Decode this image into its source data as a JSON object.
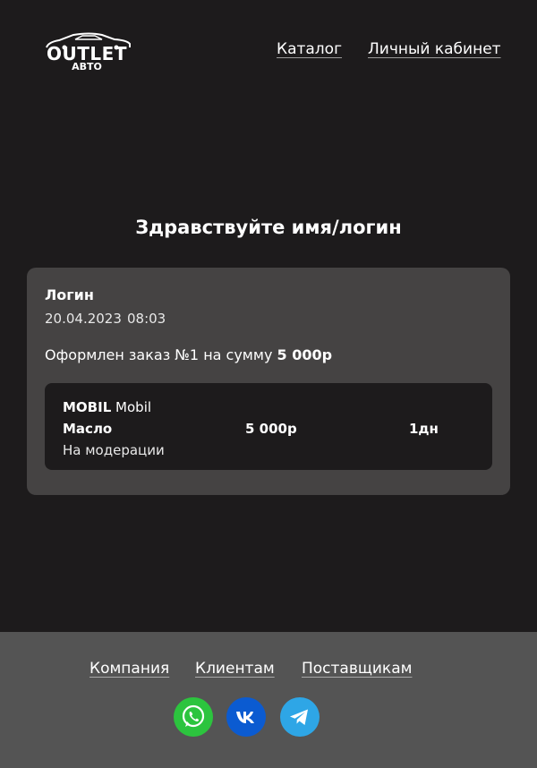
{
  "header": {
    "logo_word": "OUTLET",
    "logo_sub": "АВТО",
    "nav": {
      "catalog": "Каталог",
      "cabinet": "Личный кабинет"
    }
  },
  "main": {
    "greeting": "Здравствуйте имя/логин"
  },
  "order_card": {
    "login": "Логин",
    "date": "20.04.2023",
    "time": "08:03",
    "order_text": "Оформлен заказ №1 на сумму",
    "order_sum": "5 000р",
    "item": {
      "brand": "MOBIL",
      "brand_name": "Mobil",
      "name": "Масло",
      "price": "5 000р",
      "days": "1дн",
      "status": "На модерации"
    }
  },
  "footer": {
    "links": {
      "company": "Компания",
      "clients": "Клиентам",
      "suppliers": "Поставщикам"
    },
    "social": [
      {
        "icon": "whatsapp-icon",
        "color": "#2cc43e"
      },
      {
        "icon": "vk-icon",
        "color": "#0b5bd1"
      },
      {
        "icon": "telegram-icon",
        "color": "#2ea6e6"
      }
    ]
  },
  "colors": {
    "background": "#1d1b1c",
    "card": "#454343",
    "footer": "#545454"
  }
}
